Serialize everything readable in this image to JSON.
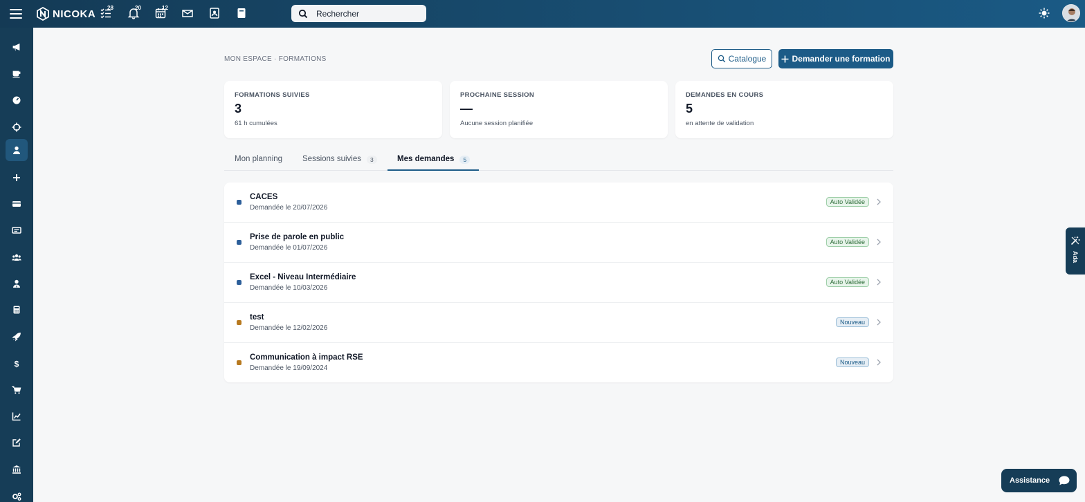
{
  "topbar": {
    "logo_text": "NICOKA",
    "badges": {
      "tasks": "28",
      "notifications": "20",
      "calendar": "12"
    },
    "search_placeholder": "Rechercher"
  },
  "sidebar": {
    "items": [
      "megaphone-icon",
      "coffee-icon",
      "gauge-icon",
      "crosshair-icon",
      "user-icon",
      "plus-icon",
      "card-icon",
      "id-card-icon",
      "users-icon",
      "user-tie-icon",
      "calculator-icon",
      "rocket-icon",
      "dollar-icon",
      "cart-icon",
      "chart-icon",
      "edit-icon",
      "bank-icon",
      "cogs-icon"
    ],
    "active_index": 4
  },
  "breadcrumb": "MON ESPACE · FORMATIONS",
  "actions": {
    "catalogue_label": "Catalogue",
    "request_label": "Demander une formation"
  },
  "stats": [
    {
      "label": "FORMATIONS SUIVIES",
      "value": "3",
      "sub": "61 h cumulées"
    },
    {
      "label": "PROCHAINE SESSION",
      "value": "—",
      "sub": "Aucune session planifiée"
    },
    {
      "label": "DEMANDES EN COURS",
      "value": "5",
      "sub": "en attente de validation"
    }
  ],
  "tabs": [
    {
      "label": "Mon planning",
      "count": ""
    },
    {
      "label": "Sessions suivies",
      "count": "3"
    },
    {
      "label": "Mes demandes",
      "count": "5"
    }
  ],
  "requests": [
    {
      "title": "CACES",
      "date": "Demandée le 20/07/2026",
      "status": "Auto Validée",
      "kind": "ok"
    },
    {
      "title": "Prise de parole en public",
      "date": "Demandée le 01/07/2026",
      "status": "Auto Validée",
      "kind": "ok"
    },
    {
      "title": "Excel - Niveau Intermédiaire",
      "date": "Demandée le 10/03/2026",
      "status": "Auto Validée",
      "kind": "ok"
    },
    {
      "title": "test",
      "date": "Demandée le 12/02/2026",
      "status": "Nouveau",
      "kind": "new"
    },
    {
      "title": "Communication à impact RSE",
      "date": "Demandée le 19/09/2024",
      "status": "Nouveau",
      "kind": "new"
    }
  ],
  "colors": {
    "primary": "#1c5b87",
    "dot_ok": "#2d5f9a",
    "dot_new": "#b7791f"
  },
  "side_panel": {
    "ada_label": "Ada"
  },
  "assistance_label": "Assistance"
}
